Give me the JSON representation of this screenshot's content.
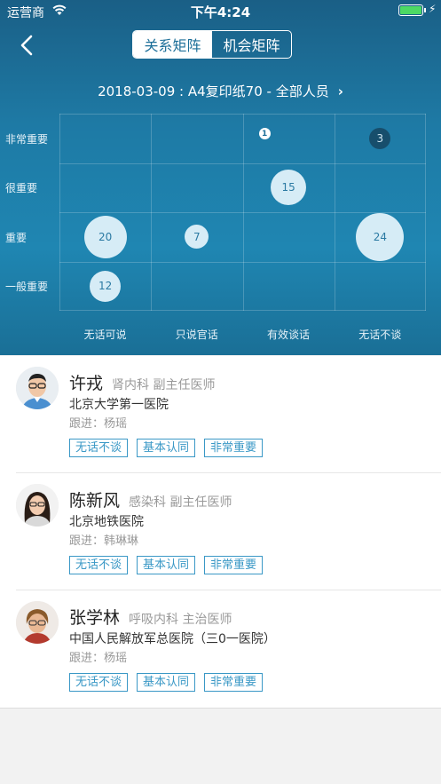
{
  "status_bar": {
    "carrier": "运营商",
    "time": "下午4:24"
  },
  "nav": {
    "tabs": [
      {
        "label": "关系矩阵",
        "active": true
      },
      {
        "label": "机会矩阵",
        "active": false
      }
    ]
  },
  "header": {
    "subtitle": "2018-03-09 : A4复印纸70 - 全部人员"
  },
  "chart_data": {
    "type": "scatter",
    "x_categories": [
      "无话可说",
      "只说官话",
      "有效谈话",
      "无话不谈"
    ],
    "y_categories": [
      "非常重要",
      "很重要",
      "重要",
      "一般重要"
    ],
    "points": [
      {
        "x": "有效谈话",
        "y": "非常重要",
        "value": 1
      },
      {
        "x": "无话不谈",
        "y": "非常重要",
        "value": 3
      },
      {
        "x": "有效谈话",
        "y": "很重要",
        "value": 15
      },
      {
        "x": "无话可说",
        "y": "重要",
        "value": 20
      },
      {
        "x": "只说官话",
        "y": "重要",
        "value": 7
      },
      {
        "x": "无话不谈",
        "y": "重要",
        "value": 24
      },
      {
        "x": "无话可说",
        "y": "一般重要",
        "value": 12
      }
    ]
  },
  "contacts": [
    {
      "name": "许戎",
      "dept": "肾内科 副主任医师",
      "hospital": "北京大学第一医院",
      "follow": "跟进：杨瑶",
      "tags": [
        "无话不谈",
        "基本认同",
        "非常重要"
      ]
    },
    {
      "name": "陈新风",
      "dept": "感染科 副主任医师",
      "hospital": "北京地铁医院",
      "follow": "跟进：韩琳琳",
      "tags": [
        "无话不谈",
        "基本认同",
        "非常重要"
      ]
    },
    {
      "name": "张学林",
      "dept": "呼吸内科 主治医师",
      "hospital": "中国人民解放军总医院（三0一医院）",
      "follow": "跟进：杨瑶",
      "tags": [
        "无话不谈",
        "基本认同",
        "非常重要"
      ]
    }
  ],
  "colors": {
    "header_bg": "#1e7aa5",
    "tag": "#3a98c6",
    "battery": "#4cd964"
  }
}
